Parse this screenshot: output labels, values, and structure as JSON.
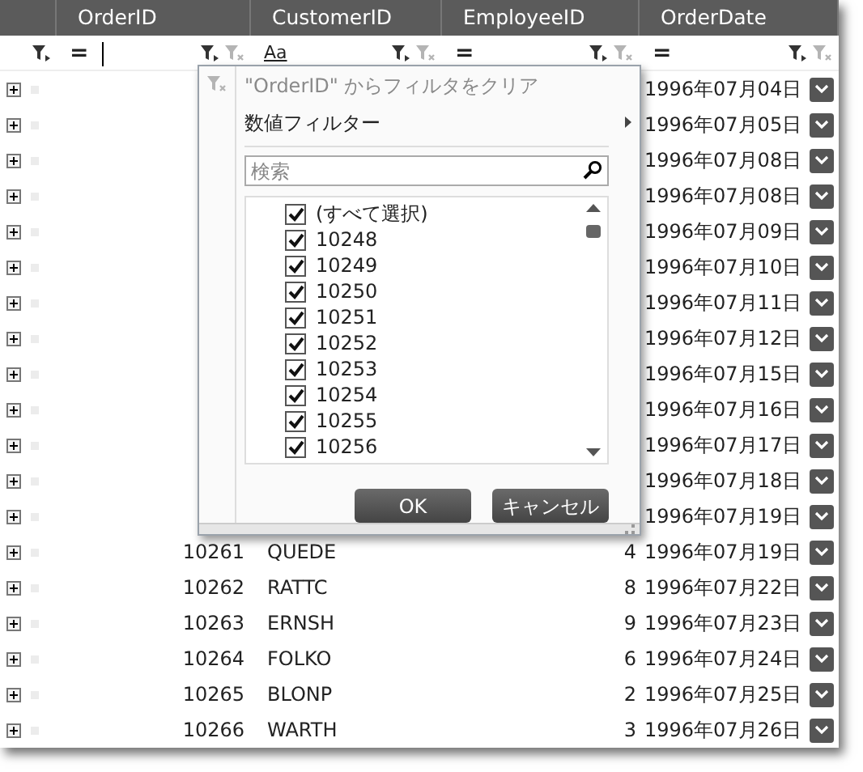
{
  "columns": [
    {
      "header": "OrderID",
      "operator": "=",
      "focused": true,
      "clear_enabled": false
    },
    {
      "header": "CustomerID",
      "operator": "Aa",
      "focused": false,
      "clear_enabled": false
    },
    {
      "header": "EmployeeID",
      "operator": "=",
      "focused": false,
      "clear_enabled": false
    },
    {
      "header": "OrderDate",
      "operator": "=",
      "focused": false,
      "clear_enabled": false
    }
  ],
  "rows": [
    {
      "order_date": "1996年07月04日"
    },
    {
      "order_date": "1996年07月05日"
    },
    {
      "order_date": "1996年07月08日"
    },
    {
      "order_date": "1996年07月08日"
    },
    {
      "order_date": "1996年07月09日"
    },
    {
      "order_date": "1996年07月10日"
    },
    {
      "order_date": "1996年07月11日"
    },
    {
      "order_date": "1996年07月12日"
    },
    {
      "order_date": "1996年07月15日"
    },
    {
      "order_date": "1996年07月16日"
    },
    {
      "order_date": "1996年07月17日"
    },
    {
      "order_date": "1996年07月18日"
    },
    {
      "order_date": "1996年07月19日"
    },
    {
      "order_id": "10261",
      "customer_id": "QUEDE",
      "employee_id": "4",
      "order_date": "1996年07月19日"
    },
    {
      "order_id": "10262",
      "customer_id": "RATTC",
      "employee_id": "8",
      "order_date": "1996年07月22日"
    },
    {
      "order_id": "10263",
      "customer_id": "ERNSH",
      "employee_id": "9",
      "order_date": "1996年07月23日"
    },
    {
      "order_id": "10264",
      "customer_id": "FOLKO",
      "employee_id": "6",
      "order_date": "1996年07月24日"
    },
    {
      "order_id": "10265",
      "customer_id": "BLONP",
      "employee_id": "2",
      "order_date": "1996年07月25日"
    },
    {
      "order_id": "10266",
      "customer_id": "WARTH",
      "employee_id": "3",
      "order_date": "1996年07月26日"
    }
  ],
  "filter_popup": {
    "clear_label": "\"OrderID\" からフィルタをクリア",
    "clear_disabled": true,
    "submenu_label": "数値フィルター",
    "search_placeholder": "検索",
    "items": [
      {
        "label": "(すべて選択)",
        "checked": true
      },
      {
        "label": "10248",
        "checked": true
      },
      {
        "label": "10249",
        "checked": true
      },
      {
        "label": "10250",
        "checked": true
      },
      {
        "label": "10251",
        "checked": true
      },
      {
        "label": "10252",
        "checked": true
      },
      {
        "label": "10253",
        "checked": true
      },
      {
        "label": "10254",
        "checked": true
      },
      {
        "label": "10255",
        "checked": true
      },
      {
        "label": "10256",
        "checked": true
      }
    ],
    "buttons": [
      "OK",
      "キャンセル"
    ]
  }
}
